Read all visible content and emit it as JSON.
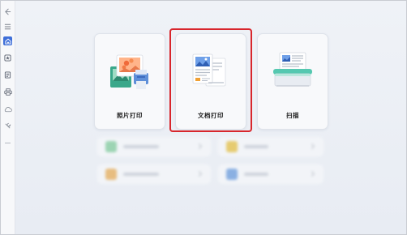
{
  "sidebar": {
    "items": [
      {
        "icon": "back-arrow-icon"
      },
      {
        "icon": "menu-icon"
      },
      {
        "icon": "home-icon",
        "active": true
      },
      {
        "icon": "star-icon"
      },
      {
        "icon": "document-icon"
      },
      {
        "icon": "printer-icon"
      },
      {
        "icon": "cloud-icon"
      },
      {
        "icon": "tools-icon"
      },
      {
        "icon": "more-icon"
      }
    ]
  },
  "main": {
    "cards": [
      {
        "label": "照片打印",
        "icon": "photo-print-icon"
      },
      {
        "label": "文档打印",
        "icon": "document-print-icon",
        "highlighted": true
      },
      {
        "label": "扫描",
        "icon": "scan-icon"
      }
    ]
  },
  "colors": {
    "accent": "#3f6fd9",
    "highlight_border": "#d8262c",
    "background": "#eef1f6"
  }
}
